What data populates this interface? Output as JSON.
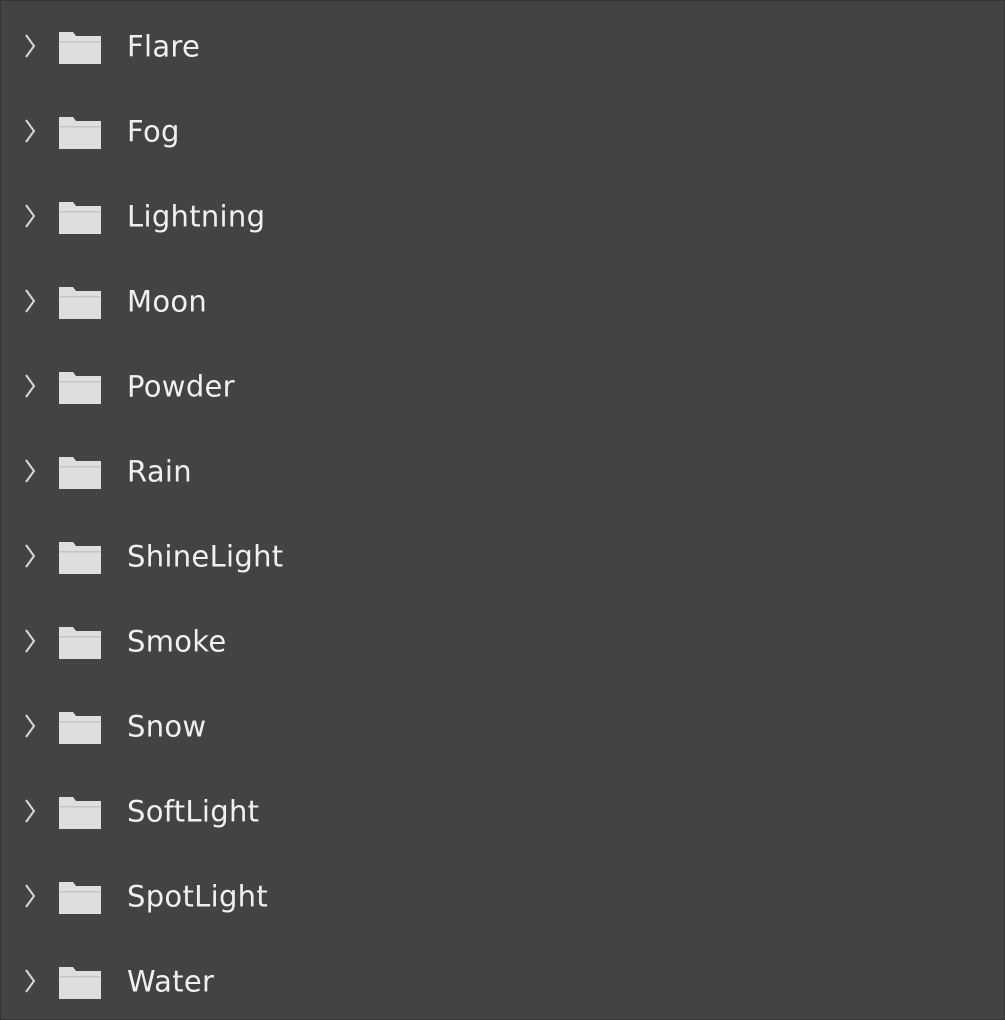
{
  "colors": {
    "background": "#434343",
    "text": "#f0f0f0",
    "folder": "#dedede",
    "chevron": "#d8d8d8"
  },
  "tree": {
    "items": [
      {
        "label": "Flare",
        "icon": "folder-icon",
        "expander": "chevron-right-icon"
      },
      {
        "label": "Fog",
        "icon": "folder-icon",
        "expander": "chevron-right-icon"
      },
      {
        "label": "Lightning",
        "icon": "folder-icon",
        "expander": "chevron-right-icon"
      },
      {
        "label": "Moon",
        "icon": "folder-icon",
        "expander": "chevron-right-icon"
      },
      {
        "label": "Powder",
        "icon": "folder-icon",
        "expander": "chevron-right-icon"
      },
      {
        "label": "Rain",
        "icon": "folder-icon",
        "expander": "chevron-right-icon"
      },
      {
        "label": "ShineLight",
        "icon": "folder-icon",
        "expander": "chevron-right-icon"
      },
      {
        "label": "Smoke",
        "icon": "folder-icon",
        "expander": "chevron-right-icon"
      },
      {
        "label": "Snow",
        "icon": "folder-icon",
        "expander": "chevron-right-icon"
      },
      {
        "label": "SoftLight",
        "icon": "folder-icon",
        "expander": "chevron-right-icon"
      },
      {
        "label": "SpotLight",
        "icon": "folder-icon",
        "expander": "chevron-right-icon"
      },
      {
        "label": "Water",
        "icon": "folder-icon",
        "expander": "chevron-right-icon"
      }
    ]
  }
}
